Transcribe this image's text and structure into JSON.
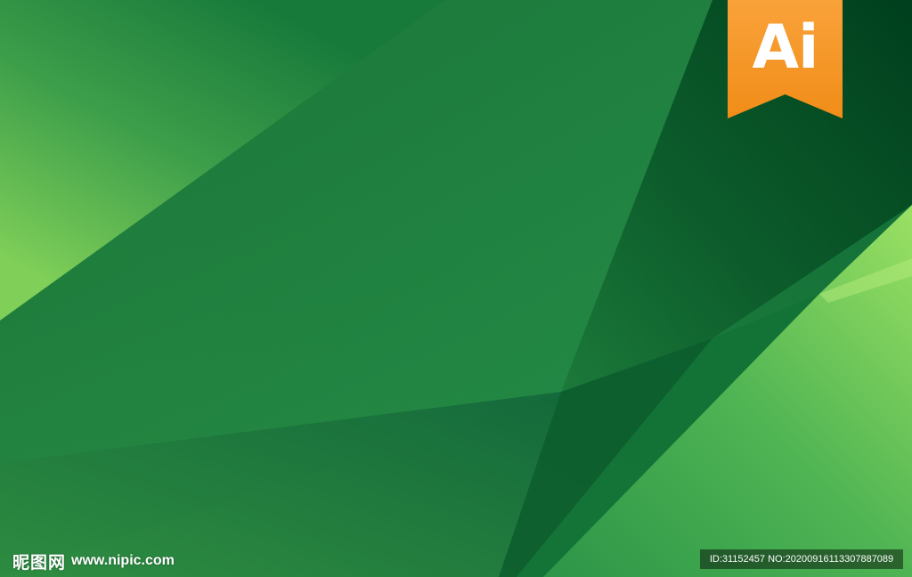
{
  "badge": {
    "label": "Ai",
    "color": "#f7941d",
    "icon": "adobe-illustrator-icon"
  },
  "watermark": {
    "logo_text": "昵图网",
    "url": "www.nipic.com"
  },
  "image_info": {
    "id_label": "ID:31152457 NO:20200916113307887089"
  },
  "colors": {
    "primary_green": "#1e7a3c",
    "dark_green": "#004a22",
    "light_green": "#8fdc5c"
  }
}
